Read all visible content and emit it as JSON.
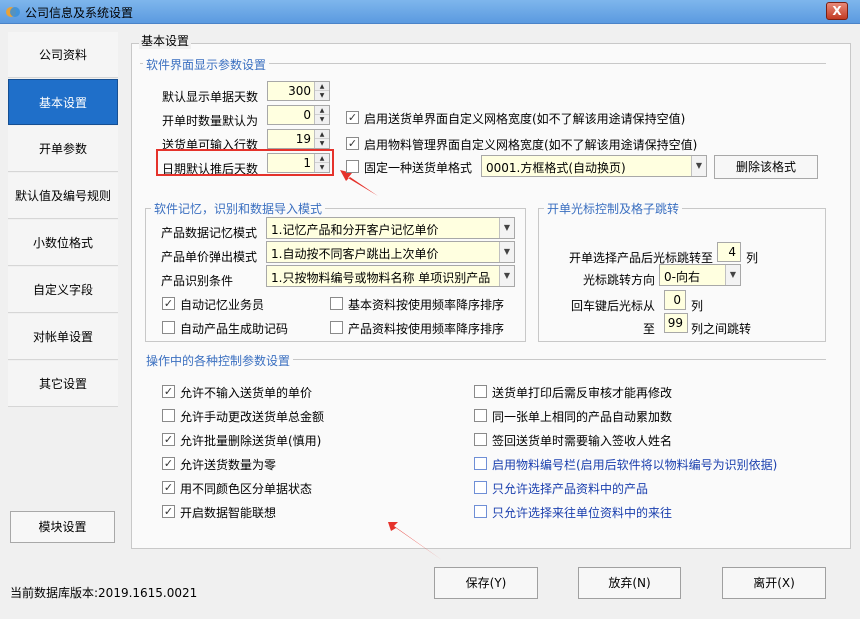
{
  "window": {
    "title": "公司信息及系统设置",
    "close_label": "X"
  },
  "sidebar": {
    "items": [
      {
        "label": "公司资料",
        "active": false
      },
      {
        "label": "基本设置",
        "active": true
      },
      {
        "label": "开单参数",
        "active": false
      },
      {
        "label": "默认值及编号规则",
        "active": false
      },
      {
        "label": "小数位格式",
        "active": false
      },
      {
        "label": "自定义字段",
        "active": false
      },
      {
        "label": "对帐单设置",
        "active": false
      },
      {
        "label": "其它设置",
        "active": false
      }
    ],
    "module_button": "模块设置"
  },
  "db_version": "当前数据库版本:2019.1615.0021",
  "main": {
    "title": "基本设置",
    "ui_group": {
      "title": "软件界面显示参数设置",
      "fields": [
        {
          "label": "默认显示单据天数",
          "value": "300"
        },
        {
          "label": "开单时数量默认为",
          "value": "0"
        },
        {
          "label": "送货单可输入行数",
          "value": "19"
        },
        {
          "label": "日期默认推后天数",
          "value": "1"
        }
      ],
      "checks": [
        {
          "label": "启用送货单界面自定义网格宽度(如不了解该用途请保持空值)",
          "checked": true
        },
        {
          "label": "启用物料管理界面自定义网格宽度(如不了解该用途请保持空值)",
          "checked": true
        },
        {
          "label": "固定一种送货单格式",
          "checked": false
        }
      ],
      "format_select": "0001.方框格式(自动换页)",
      "delete_format_button": "删除该格式"
    },
    "memory_group": {
      "title": "软件记忆，识别和数据导入模式",
      "fields": [
        {
          "label": "产品数据记忆模式",
          "value": "1.记忆产品和分开客户记忆单价"
        },
        {
          "label": "产品单价弹出模式",
          "value": "1.自动按不同客户跳出上次单价"
        },
        {
          "label": "产品识别条件",
          "value": "1.只按物料编号或物料名称 单项识别产品"
        }
      ],
      "checks": [
        {
          "label": "自动记忆业务员",
          "checked": true
        },
        {
          "label": "基本资料按使用频率降序排序",
          "checked": false
        },
        {
          "label": "自动产品生成助记码",
          "checked": false
        },
        {
          "label": "产品资料按使用频率降序排序",
          "checked": false
        }
      ]
    },
    "cursor_group": {
      "title": "开单光标控制及格子跳转",
      "jump_after_label": "开单选择产品后光标跳转至",
      "jump_after_value": "4",
      "col_unit": "列",
      "direction_label": "光标跳转方向",
      "direction_value": "0-向右",
      "enter_from_label": "回车键后光标从",
      "enter_from_value": "0",
      "to_label": "至",
      "to_value": "99",
      "between_label": "列之间跳转"
    },
    "ops_group": {
      "title": "操作中的各种控制参数设置",
      "left": [
        {
          "label": "允许不输入送货单的单价",
          "checked": true
        },
        {
          "label": "允许手动更改送货单总金额",
          "checked": false
        },
        {
          "label": "允许批量删除送货单(慎用)",
          "checked": true
        },
        {
          "label": "允许送货数量为零",
          "checked": true
        },
        {
          "label": "用不同颜色区分单据状态",
          "checked": true
        },
        {
          "label": "开启数据智能联想",
          "checked": true
        }
      ],
      "right": [
        {
          "label": "送货单打印后需反审核才能再修改",
          "checked": false,
          "blue": false
        },
        {
          "label": "同一张单上相同的产品自动累加数",
          "checked": false,
          "blue": false
        },
        {
          "label": "签回送货单时需要输入签收人姓名",
          "checked": false,
          "blue": false
        },
        {
          "label": "启用物料编号栏(启用后软件将以物料编号为识别依据)",
          "checked": false,
          "blue": true
        },
        {
          "label": "只允许选择产品资料中的产品",
          "checked": false,
          "blue": true
        },
        {
          "label": "只允许选择来往单位资料中的来往",
          "checked": false,
          "blue": true
        }
      ]
    }
  },
  "footer": {
    "save": "保存(Y)",
    "discard": "放弃(N)",
    "exit": "离开(X)"
  },
  "colors": {
    "accent": "#1f6fc9",
    "highlight": "#e5322b",
    "group_title": "#3a6fc0"
  }
}
